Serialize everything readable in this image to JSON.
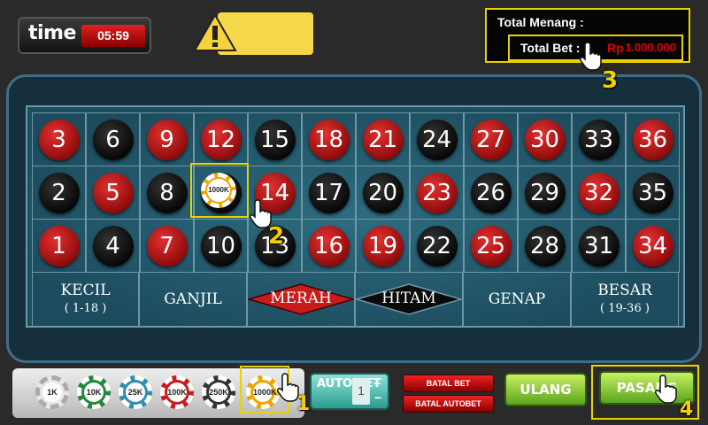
{
  "timer": {
    "label": "time",
    "value": "05:59"
  },
  "bet_panel": {
    "total_win_label": "Total Menang :",
    "total_bet_label": "Total Bet :",
    "currency": "Rp",
    "total_bet_value": "1.000.000"
  },
  "table": {
    "rows": [
      [
        {
          "n": "3",
          "c": "red"
        },
        {
          "n": "6",
          "c": "black"
        },
        {
          "n": "9",
          "c": "red"
        },
        {
          "n": "12",
          "c": "red"
        },
        {
          "n": "15",
          "c": "black"
        },
        {
          "n": "18",
          "c": "red"
        },
        {
          "n": "21",
          "c": "red"
        },
        {
          "n": "24",
          "c": "black"
        },
        {
          "n": "27",
          "c": "red"
        },
        {
          "n": "30",
          "c": "red"
        },
        {
          "n": "33",
          "c": "black"
        },
        {
          "n": "36",
          "c": "red"
        }
      ],
      [
        {
          "n": "2",
          "c": "black"
        },
        {
          "n": "5",
          "c": "red"
        },
        {
          "n": "8",
          "c": "black"
        },
        {
          "n": "11",
          "c": "black"
        },
        {
          "n": "14",
          "c": "red"
        },
        {
          "n": "17",
          "c": "black"
        },
        {
          "n": "20",
          "c": "black"
        },
        {
          "n": "23",
          "c": "red"
        },
        {
          "n": "26",
          "c": "black"
        },
        {
          "n": "29",
          "c": "black"
        },
        {
          "n": "32",
          "c": "red"
        },
        {
          "n": "35",
          "c": "black"
        }
      ],
      [
        {
          "n": "1",
          "c": "red"
        },
        {
          "n": "4",
          "c": "black"
        },
        {
          "n": "7",
          "c": "red"
        },
        {
          "n": "10",
          "c": "black"
        },
        {
          "n": "13",
          "c": "black"
        },
        {
          "n": "16",
          "c": "red"
        },
        {
          "n": "19",
          "c": "red"
        },
        {
          "n": "22",
          "c": "black"
        },
        {
          "n": "25",
          "c": "red"
        },
        {
          "n": "28",
          "c": "black"
        },
        {
          "n": "31",
          "c": "black"
        },
        {
          "n": "34",
          "c": "red"
        }
      ]
    ],
    "outside": {
      "kecil": "KECIL",
      "kecil_range": "( 1-18 )",
      "ganjil": "GANJIL",
      "merah": "MERAH",
      "hitam": "HITAM",
      "genap": "GENAP",
      "besar": "BESAR",
      "besar_range": "( 19-36 )"
    },
    "placed_chip": {
      "number": "11",
      "label": "1000K"
    }
  },
  "chips": [
    {
      "label": "1K",
      "color": "#e8e8e8"
    },
    {
      "label": "10K",
      "color": "#1f8a3a"
    },
    {
      "label": "25K",
      "color": "#2f8fb0"
    },
    {
      "label": "100K",
      "color": "#c81c1c"
    },
    {
      "label": "250K",
      "color": "#333333"
    },
    {
      "label": "1000K",
      "color": "#f0a400"
    }
  ],
  "selected_chip": "1000K",
  "buttons": {
    "auto_bet": "AUTO BET",
    "auto_bet_count": "1",
    "auto_plus": "+",
    "auto_minus": "−",
    "cancel_bet": "BATAL BET",
    "cancel_autobet": "BATAL AUTOBET",
    "repeat": "ULANG",
    "place": "PASANG"
  },
  "steps": {
    "one": "1",
    "two": "2",
    "three": "3",
    "four": "4"
  },
  "colors": {
    "highlight": "#e8d200",
    "red": "#c81c1c",
    "felt": "#2d6c80"
  }
}
